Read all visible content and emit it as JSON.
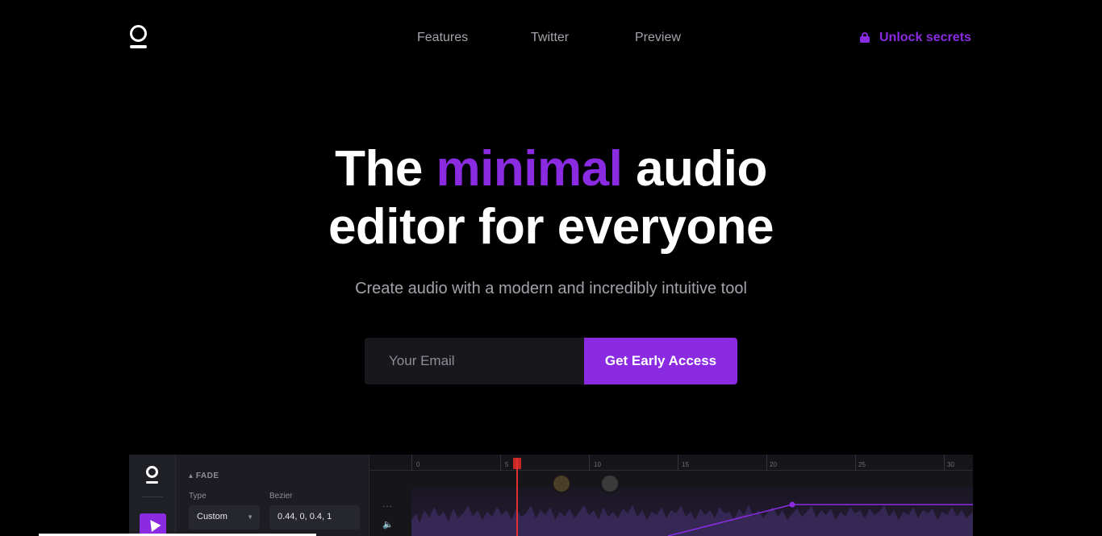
{
  "nav": {
    "logo_icon": "logo-ring-icon",
    "links": [
      "Features",
      "Twitter",
      "Preview"
    ],
    "unlock_label": "Unlock secrets",
    "unlock_icon": "lock-icon"
  },
  "hero": {
    "title_pre": "The",
    "title_accent": "minimal",
    "title_mid": "audio",
    "title_line2": "editor for everyone",
    "subtitle": "Create audio with a modern and incredibly intuitive tool",
    "accent_color": "#8a2be2"
  },
  "signup": {
    "email_placeholder": "Your Email",
    "cta_label": "Get Early Access"
  },
  "preview": {
    "section_label": "FADE",
    "type_label": "Type",
    "type_value": "Custom",
    "bezier_label": "Bezier",
    "bezier_value": "0.44, 0, 0.4, 1",
    "ruler_ticks": [
      "0",
      "5",
      "10",
      "15",
      "20",
      "25",
      "30"
    ],
    "more_glyph": "...",
    "speaker_glyph": "🔈"
  }
}
